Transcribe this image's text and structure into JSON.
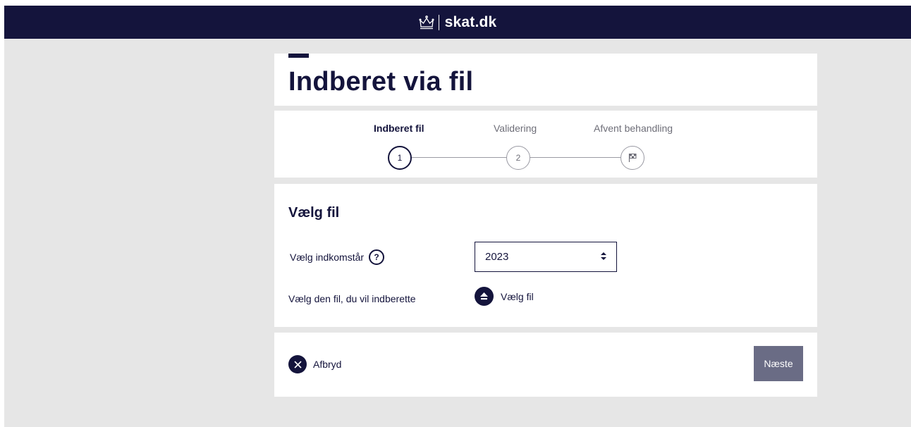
{
  "header": {
    "logo_text": "skat.dk",
    "logo_icon": "crown-icon",
    "background_color": "#14143c"
  },
  "page": {
    "title": "Indberet via fil"
  },
  "stepper": {
    "steps": [
      {
        "label": "Indberet fil",
        "marker": "1",
        "state": "active"
      },
      {
        "label": "Validering",
        "marker": "2",
        "state": "inactive"
      },
      {
        "label": "Afvent behandling",
        "marker": "flag-icon",
        "state": "inactive"
      }
    ]
  },
  "form": {
    "section_title": "Vælg fil",
    "year_label": "Vælg indkomstår",
    "help_icon_text": "?",
    "year_value": "2023",
    "file_label": "Vælg den fil, du vil indberette",
    "upload_label": "Vælg fil",
    "upload_icon": "upload-arrow-icon"
  },
  "footer": {
    "cancel_label": "Afbryd",
    "cancel_icon": "close-icon",
    "next_label": "Næste",
    "next_button_color": "#6a6c85"
  }
}
